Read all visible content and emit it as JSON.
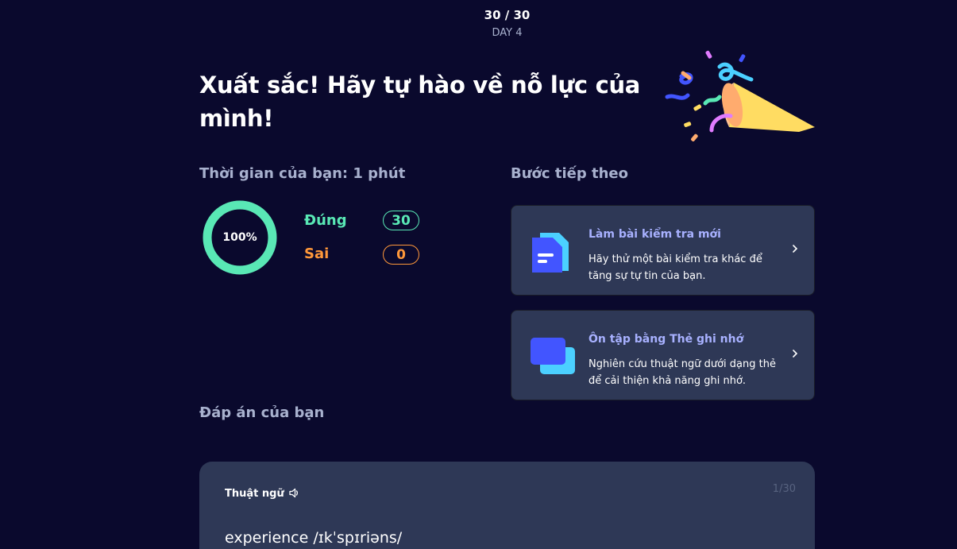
{
  "progress": {
    "count": "30 / 30",
    "day": "DAY 4"
  },
  "headline": "Xuất sắc! Hãy tự hào về nỗ lực của mình!",
  "results": {
    "time_heading": "Thời gian của bạn: 1 phút",
    "percent": "100%",
    "percent_value": 1.0,
    "correct_label": "Đúng",
    "correct_count": "30",
    "incorrect_label": "Sai",
    "incorrect_count": "0"
  },
  "next_steps": {
    "heading": "Bước tiếp theo",
    "cards": [
      {
        "title": "Làm bài kiểm tra mới",
        "description": "Hãy thử một bài kiểm tra khác để tăng sự tự tin của bạn.",
        "icon": "test-document-icon"
      },
      {
        "title": "Ôn tập bằng Thẻ ghi nhớ",
        "description": "Nghiên cứu thuật ngữ dưới dạng thẻ để cải thiện khả năng ghi nhớ.",
        "icon": "flashcards-icon"
      }
    ]
  },
  "answers": {
    "heading": "Đáp án của bạn",
    "term_label": "Thuật ngữ",
    "counter": "1/30",
    "term": "experience /ɪkˈspɪriəns/"
  },
  "colors": {
    "background": "#0a092d",
    "card": "#2e3856",
    "correct": "#59e8b5",
    "incorrect": "#ff983a",
    "link": "#a8b1ff"
  }
}
